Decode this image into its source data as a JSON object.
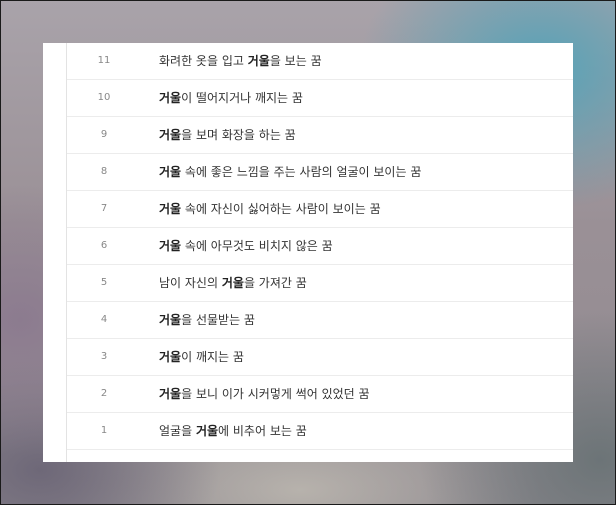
{
  "dream_list": [
    {
      "num": "11",
      "pre": "화려한 옷을 입고 ",
      "bold": "거울",
      "post": "을 보는 꿈"
    },
    {
      "num": "10",
      "pre": "",
      "bold": "거울",
      "post": "이 떨어지거나 깨지는 꿈"
    },
    {
      "num": "9",
      "pre": "",
      "bold": "거울",
      "post": "을 보며 화장을 하는 꿈"
    },
    {
      "num": "8",
      "pre": "",
      "bold": "거울",
      "post": " 속에 좋은 느낌을 주는 사람의 얼굴이 보이는 꿈"
    },
    {
      "num": "7",
      "pre": "",
      "bold": "거울",
      "post": " 속에 자신이 싫어하는 사람이 보이는 꿈"
    },
    {
      "num": "6",
      "pre": "",
      "bold": "거울",
      "post": " 속에 아무것도 비치지 않은 꿈"
    },
    {
      "num": "5",
      "pre": "남이 자신의 ",
      "bold": "거울",
      "post": "을 가져간 꿈"
    },
    {
      "num": "4",
      "pre": "",
      "bold": "거울",
      "post": "을 선물받는 꿈"
    },
    {
      "num": "3",
      "pre": "",
      "bold": "거울",
      "post": "이 깨지는 꿈"
    },
    {
      "num": "2",
      "pre": "",
      "bold": "거울",
      "post": "을 보니 이가 시커멓게 썩어 있었던 꿈"
    },
    {
      "num": "1",
      "pre": "얼굴을 ",
      "bold": "거울",
      "post": "에 비추어 보는 꿈"
    }
  ]
}
